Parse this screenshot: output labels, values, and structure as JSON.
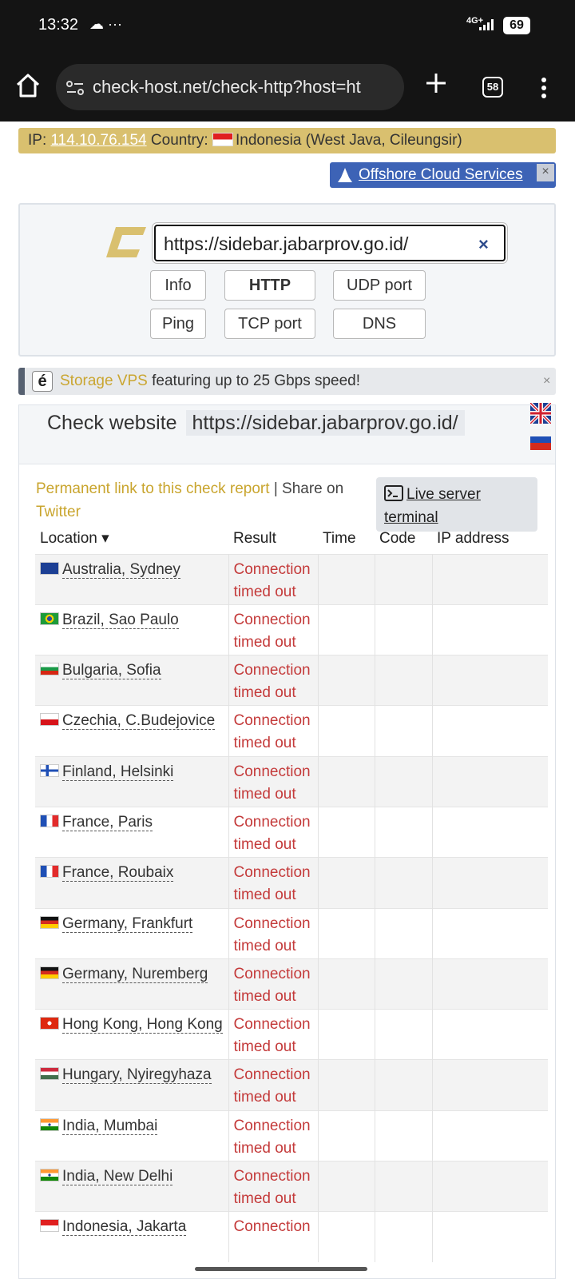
{
  "status_bar": {
    "time": "13:32",
    "extra_icons": "☁ ···",
    "network": "4G+",
    "battery": "69"
  },
  "browser": {
    "url": "check-host.net/check-http?host=ht",
    "tab_count": "58"
  },
  "ip_bar": {
    "ip_label": "IP:",
    "ip": "114.10.76.154",
    "country_label": "Country:",
    "country": "Indonesia (West Java, Cileungsir)"
  },
  "offshore_ad": {
    "label": "Offshore Cloud Services",
    "close": "×"
  },
  "check_form": {
    "host_value": "https://sidebar.jabarprov.go.id/",
    "clear": "×",
    "buttons": [
      "Info",
      "HTTP",
      "UDP port",
      "Ping",
      "TCP port",
      "DNS"
    ],
    "active": "HTTP"
  },
  "vps_ad": {
    "icon": "é",
    "highlight": "Storage VPS",
    "text": " featuring up to 25 Gbps speed!",
    "close": "×"
  },
  "report": {
    "title_prefix": "Check website",
    "host": "https://sidebar.jabarprov.go.id/",
    "permalink": "Permanent link to this check report",
    "separator": "|",
    "share_text": "Share on",
    "twitter": "Twitter",
    "terminal_line1": "Live server",
    "terminal_line2": "terminal"
  },
  "table": {
    "headers": [
      "Location ▾",
      "Result",
      "Time",
      "Code",
      "IP address"
    ],
    "rows": [
      {
        "location": "Australia, Sydney",
        "flag": "au",
        "result_line1": "Connection",
        "result_line2": "timed out"
      },
      {
        "location": "Brazil, Sao Paulo",
        "flag": "br",
        "result_line1": "Connection",
        "result_line2": "timed out"
      },
      {
        "location": "Bulgaria, Sofia",
        "flag": "bg",
        "result_line1": "Connection",
        "result_line2": "timed out"
      },
      {
        "location": "Czechia, C.Budejovice",
        "flag": "cz",
        "result_line1": "Connection",
        "result_line2": "timed out"
      },
      {
        "location": "Finland, Helsinki",
        "flag": "fi",
        "result_line1": "Connection",
        "result_line2": "timed out"
      },
      {
        "location": "France, Paris",
        "flag": "fr",
        "result_line1": "Connection",
        "result_line2": "timed out"
      },
      {
        "location": "France, Roubaix",
        "flag": "fr",
        "result_line1": "Connection",
        "result_line2": "timed out"
      },
      {
        "location": "Germany, Frankfurt",
        "flag": "de",
        "result_line1": "Connection",
        "result_line2": "timed out"
      },
      {
        "location": "Germany, Nuremberg",
        "flag": "de",
        "result_line1": "Connection",
        "result_line2": "timed out"
      },
      {
        "location": "Hong Kong, Hong Kong",
        "flag": "hk",
        "result_line1": "Connection",
        "result_line2": "timed out"
      },
      {
        "location": "Hungary, Nyiregyhaza",
        "flag": "hu",
        "result_line1": "Connection",
        "result_line2": "timed out"
      },
      {
        "location": "India, Mumbai",
        "flag": "in",
        "result_line1": "Connection",
        "result_line2": "timed out"
      },
      {
        "location": "India, New Delhi",
        "flag": "in",
        "result_line1": "Connection",
        "result_line2": "timed out"
      },
      {
        "location": "Indonesia, Jakarta",
        "flag": "id",
        "result_line1": "Connection",
        "result_line2": ""
      }
    ]
  }
}
